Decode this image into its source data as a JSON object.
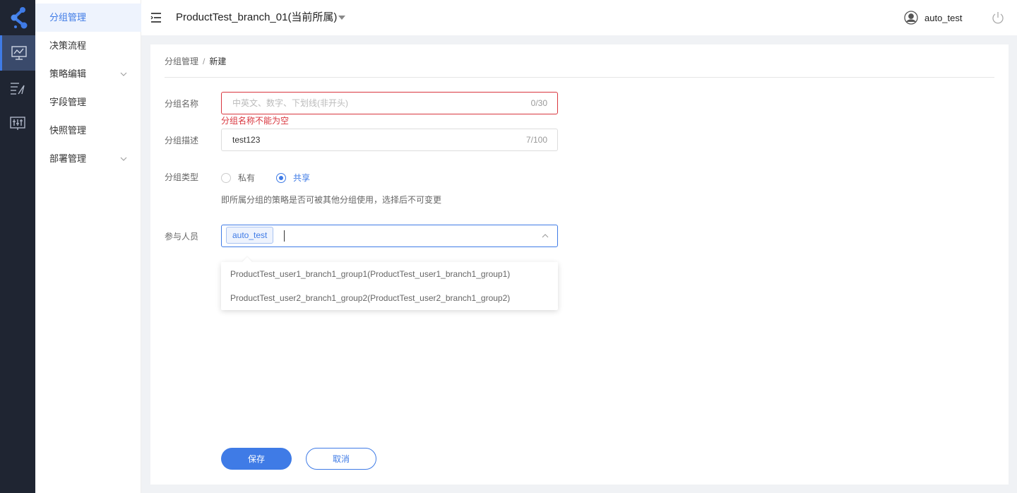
{
  "rail": {
    "items": [
      {
        "icon": "monitor-chart-icon",
        "active": true
      },
      {
        "icon": "list-flag-icon",
        "active": false
      },
      {
        "icon": "sliders-board-icon",
        "active": false
      }
    ]
  },
  "submenu": {
    "items": [
      {
        "label": "分组管理",
        "active": true,
        "expandable": false
      },
      {
        "label": "决策流程",
        "active": false,
        "expandable": false
      },
      {
        "label": "策略编辑",
        "active": false,
        "expandable": true
      },
      {
        "label": "字段管理",
        "active": false,
        "expandable": false
      },
      {
        "label": "快照管理",
        "active": false,
        "expandable": false
      },
      {
        "label": "部署管理",
        "active": false,
        "expandable": true
      }
    ]
  },
  "header": {
    "branch": "ProductTest_branch_01(当前所属)",
    "user": "auto_test"
  },
  "breadcrumb": {
    "parent": "分组管理",
    "separator": "/",
    "current": "新建"
  },
  "form": {
    "name": {
      "label": "分组名称",
      "placeholder": "中英文、数字、下划线(非开头)",
      "value": "",
      "count": "0/30",
      "error": "分组名称不能为空"
    },
    "desc": {
      "label": "分组描述",
      "value": "test123",
      "count": "7/100"
    },
    "type": {
      "label": "分组类型",
      "options": [
        "私有",
        "共享"
      ],
      "selected": "共享",
      "hint": "即所属分组的策略是否可被其他分组使用，选择后不可变更"
    },
    "members": {
      "label": "参与人员",
      "tags": [
        "auto_test"
      ],
      "options": [
        "ProductTest_user1_branch1_group1(ProductTest_user1_branch1_group1)",
        "ProductTest_user2_branch1_group2(ProductTest_user2_branch1_group2)"
      ]
    }
  },
  "actions": {
    "save": "保存",
    "cancel": "取消"
  },
  "colors": {
    "accent": "#3f7be6",
    "error": "#d9363e",
    "rail_bg": "#1f2532"
  }
}
